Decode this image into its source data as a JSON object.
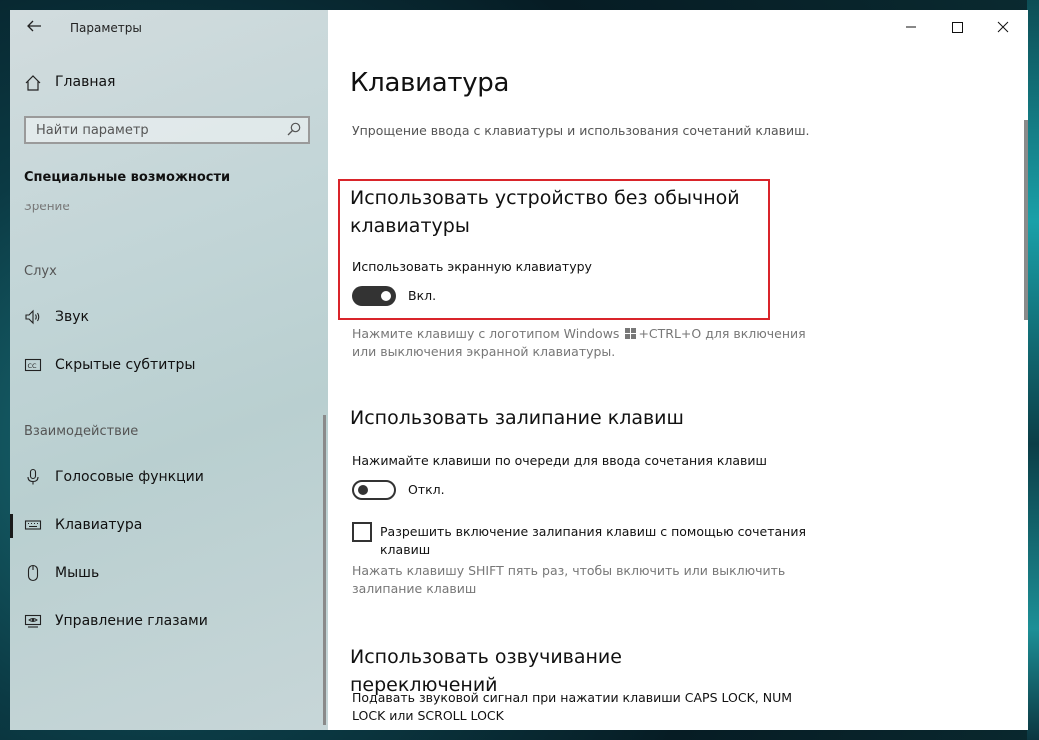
{
  "window": {
    "app_title": "Параметры"
  },
  "sidebar": {
    "home_label": "Главная",
    "search": {
      "placeholder": "Найти параметр",
      "value": ""
    },
    "section_title": "Специальные возможности",
    "cut_off_item": "Зрение",
    "groups": {
      "hearing": "Слух",
      "interaction": "Взаимодействие"
    },
    "items": [
      {
        "label": "Звук",
        "icon": "speaker-icon"
      },
      {
        "label": "Скрытые субтитры",
        "icon": "closed-captions-icon"
      },
      {
        "label": "Голосовые функции",
        "icon": "microphone-icon"
      },
      {
        "label": "Клавиатура",
        "icon": "keyboard-icon",
        "selected": true
      },
      {
        "label": "Мышь",
        "icon": "mouse-icon"
      },
      {
        "label": "Управление глазами",
        "icon": "eye-control-icon"
      }
    ]
  },
  "main": {
    "title": "Клавиатура",
    "subtitle": "Упрощение ввода с клавиатуры и использования сочетаний клавиш.",
    "onscreen": {
      "heading_line1": "Использовать устройство без обычной",
      "heading_line2": "клавиатуры",
      "setting_label": "Использовать экранную клавиатуру",
      "state": "Вкл.",
      "is_on": true,
      "hint_part1": "Нажмите клавишу с логотипом Windows",
      "hint_part2": "+CTRL+O для включения",
      "hint_line2": "или выключения экранной клавиатуры."
    },
    "sticky": {
      "heading": "Использовать залипание клавиш",
      "setting_label": "Нажимайте клавиши по очереди для ввода сочетания клавиш",
      "state": "Откл.",
      "is_on": false,
      "checkbox_line1": "Разрешить включение залипания клавиш с помощью сочетания",
      "checkbox_line2": "клавиш",
      "checkbox_checked": false,
      "hint_line1": "Нажать клавишу SHIFT пять раз, чтобы включить или выключить",
      "hint_line2": "залипание клавиш"
    },
    "toggle_keys": {
      "heading": "Использовать озвучивание переключений",
      "desc_line1": "Подавать звуковой сигнал при нажатии клавиши CAPS LOCK, NUM",
      "desc_line2": "LOCK или SCROLL LOCK"
    }
  },
  "colors": {
    "highlight_border": "#d9242a",
    "toggle_on": "#333333",
    "accent_text": "#111111"
  }
}
